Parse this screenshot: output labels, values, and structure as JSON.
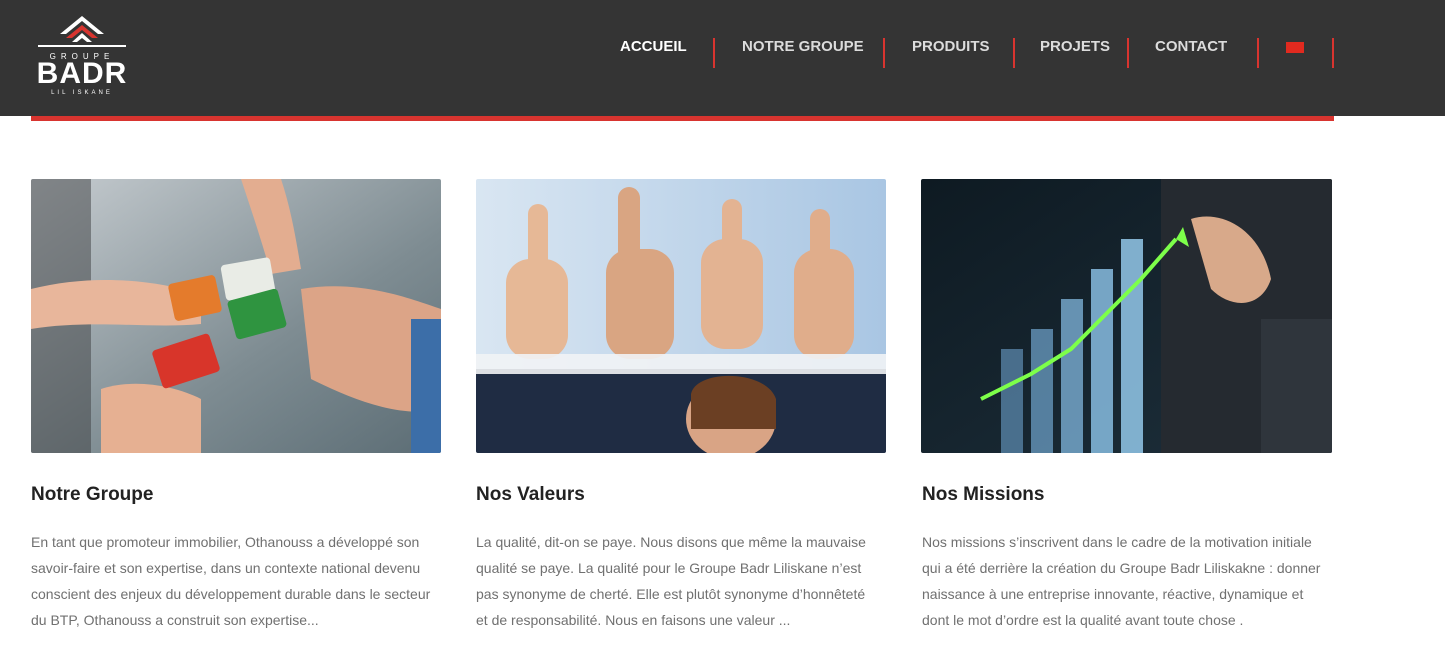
{
  "brand": {
    "group": "GROUPE",
    "name": "BADR",
    "tagline": "LIL ISKANE"
  },
  "nav": {
    "items": [
      {
        "label": "ACCUEIL",
        "active": true
      },
      {
        "label": "NOTRE GROUPE",
        "active": false
      },
      {
        "label": "PRODUITS",
        "active": false
      },
      {
        "label": "PROJETS",
        "active": false
      },
      {
        "label": "CONTACT",
        "active": false
      }
    ],
    "flag_icon": "flag-icon",
    "accent_color": "#d8342f",
    "header_bg": "#343434"
  },
  "cards": [
    {
      "title": "Notre Groupe",
      "image": "puzzle-hands-image",
      "text": "En tant que promoteur immobilier, Othanouss a développé son savoir-faire et son expertise, dans un contexte national devenu conscient des enjeux du développement durable dans le secteur du BTP, Othanouss a construit son expertise..."
    },
    {
      "title": "Nos Valeurs",
      "image": "thumbs-up-image",
      "text": "La qualité, dit-on se paye. Nous disons que même la mauvaise qualité se paye. La qualité pour le Groupe Badr Liliskane n’est pas synonyme de cherté. Elle est plutôt synonyme d’honnêteté et de responsabilité. Nous en faisons une valeur ..."
    },
    {
      "title": "Nos Missions",
      "image": "growth-chart-image",
      "text": "Nos missions s’inscrivent dans le cadre de la motivation initiale qui a été derrière la création du Groupe Badr Liliskakne : donner naissance à une entreprise innovante, réactive, dynamique et dont le mot d’ordre est la qualité avant toute chose ."
    }
  ]
}
